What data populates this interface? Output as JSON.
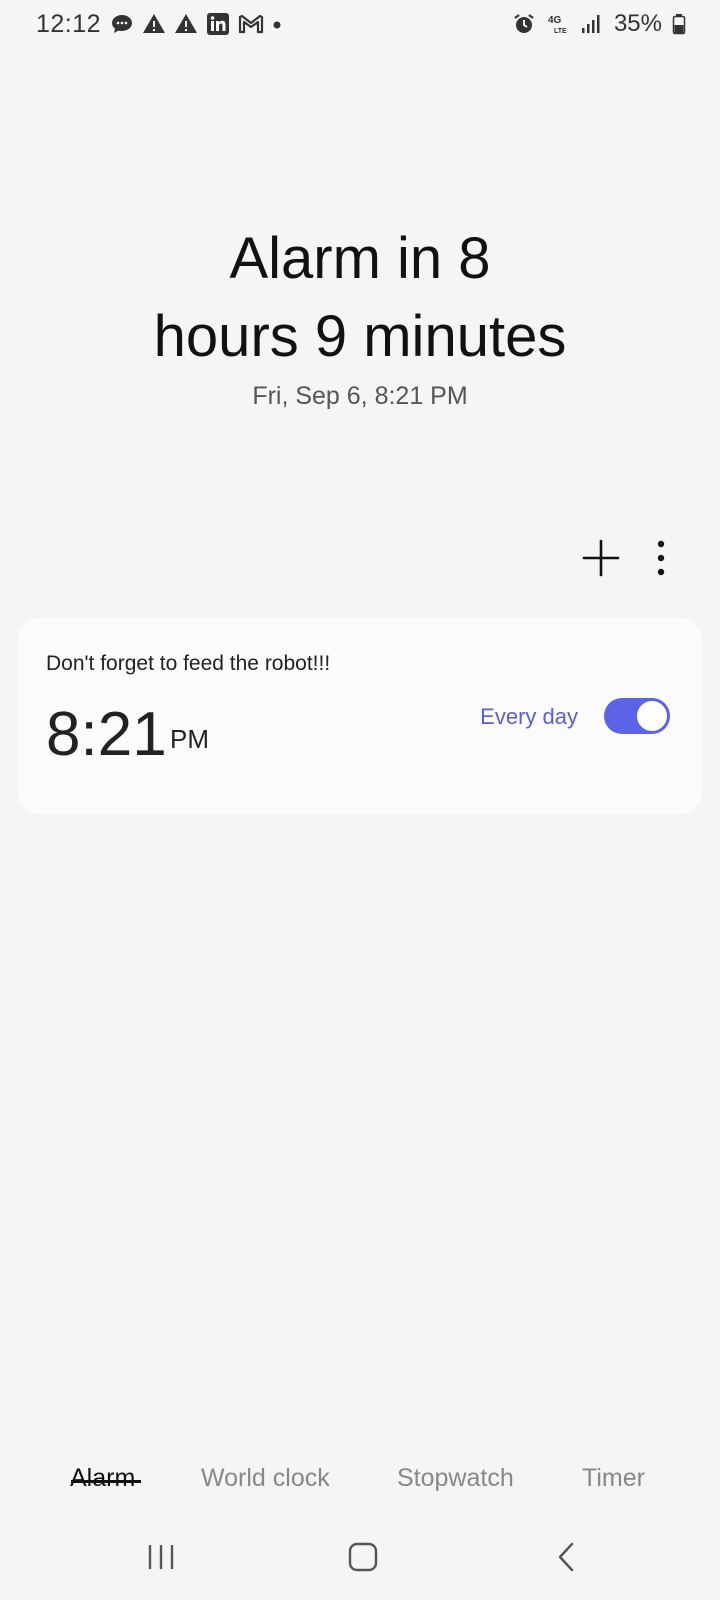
{
  "status_bar": {
    "time": "12:12",
    "battery": "35%",
    "left_icons": [
      "messages-icon",
      "warning-icon",
      "warning-icon",
      "linkedin-icon",
      "gmail-icon",
      "dot-icon"
    ],
    "right_icons": [
      "alarm-icon",
      "4g-lte-icon",
      "signal-icon",
      "battery-icon"
    ]
  },
  "header": {
    "line1": "Alarm in 8",
    "line2": "hours 9 minutes",
    "date": "Fri, Sep 6, 8:21 PM"
  },
  "toolbar": {
    "add_icon": "plus-icon",
    "more_icon": "more-vertical-icon"
  },
  "alarms": [
    {
      "label": "Don't forget to feed the robot!!!",
      "time": "8:21",
      "ampm": "PM",
      "repeat": "Every day",
      "enabled": true
    }
  ],
  "tabs": [
    {
      "label": "Alarm",
      "active": true
    },
    {
      "label": "World clock",
      "active": false
    },
    {
      "label": "Stopwatch",
      "active": false
    },
    {
      "label": "Timer",
      "active": false
    }
  ],
  "colors": {
    "accent": "#5b63e6",
    "background": "#f5f5f5",
    "card": "#fbfbfb"
  }
}
